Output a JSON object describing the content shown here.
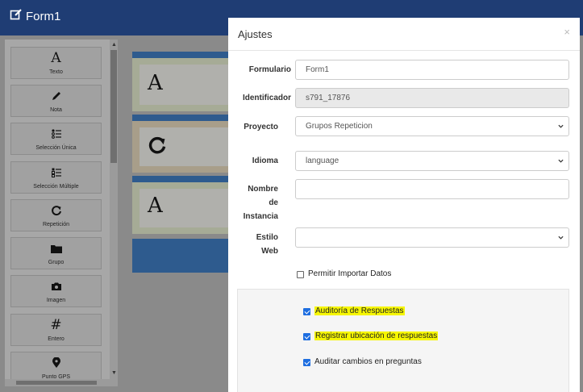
{
  "header": {
    "title": "Form1"
  },
  "toolbox": {
    "items": [
      {
        "label": "Texto",
        "icon": "text-a-icon"
      },
      {
        "label": "Nota",
        "icon": "pencil-icon"
      },
      {
        "label": "Selección Única",
        "icon": "single-select-icon"
      },
      {
        "label": "Selección Múltiple",
        "icon": "multi-select-icon"
      },
      {
        "label": "Repetición",
        "icon": "repeat-icon"
      },
      {
        "label": "Grupo",
        "icon": "folder-icon"
      },
      {
        "label": "Imagen",
        "icon": "camera-icon"
      },
      {
        "label": "Entero",
        "icon": "hash-icon"
      },
      {
        "label": "Punto GPS",
        "icon": "map-pin-icon"
      }
    ]
  },
  "canvas": {
    "block_glyphs": [
      "A",
      "A"
    ]
  },
  "modal": {
    "title": "Ajustes",
    "close": "×",
    "fields": {
      "formulario": {
        "label": "Formulario",
        "value": "Form1"
      },
      "identificador": {
        "label": "Identificador",
        "value": "s791_17876"
      },
      "proyecto": {
        "label": "Proyecto",
        "value": "Grupos Repeticion"
      },
      "idioma": {
        "label": "Idioma",
        "value": "language"
      },
      "nombre_instancia": {
        "label_lines": [
          "Nombre",
          "de",
          "Instancia"
        ],
        "value": ""
      },
      "estilo_web": {
        "label_lines": [
          "Estilo",
          "Web"
        ],
        "value": ""
      }
    },
    "permitir_importar": {
      "label": "Permitir Importar Datos",
      "checked": false
    },
    "options": [
      {
        "label": "Auditoría de Respuestas",
        "checked": true,
        "highlighted": true
      },
      {
        "label": "Registrar ubicación de respuestas",
        "checked": true,
        "highlighted": true
      },
      {
        "label": "Auditar cambios en preguntas",
        "checked": true,
        "highlighted": false
      }
    ]
  },
  "colors": {
    "header": "#1f3d74",
    "accent": "#1e6ee0",
    "highlight": "#f6f600"
  }
}
